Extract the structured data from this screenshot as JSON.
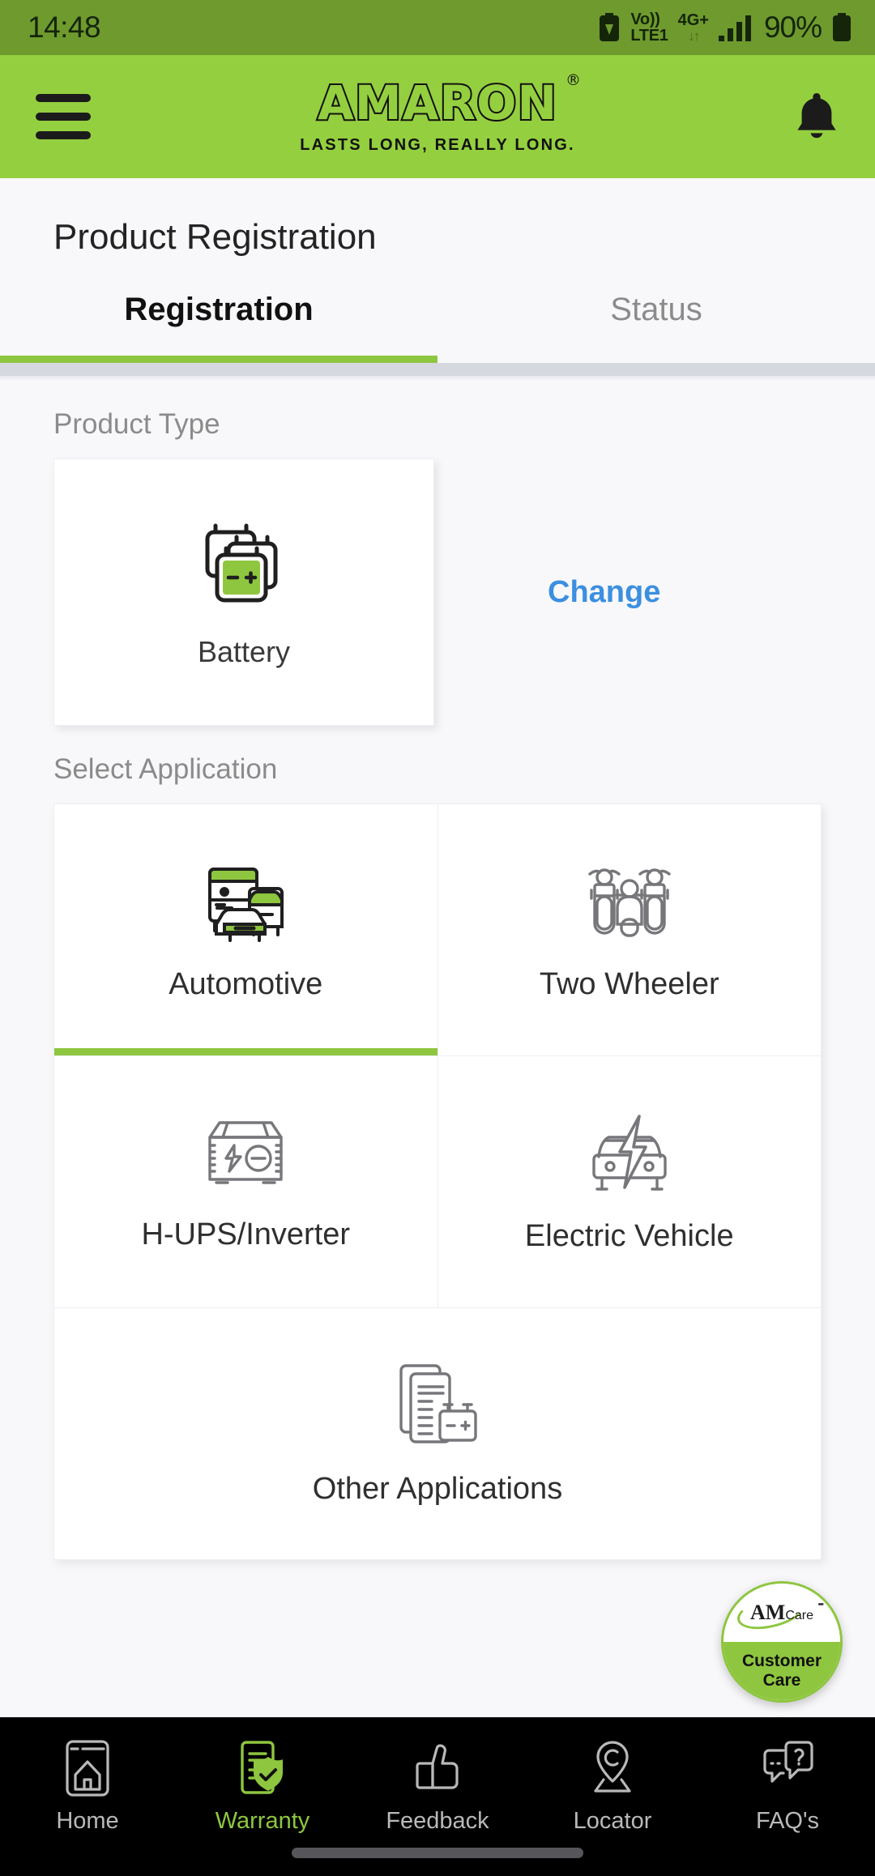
{
  "status_bar": {
    "time": "14:48",
    "battery_saver_icon": "battery-saver-icon",
    "volte_line1": "Vo))",
    "volte_line2": "LTE1",
    "network_type": "4G+",
    "data_arrows": "↓↑",
    "signal_icon": "signal-bars-icon",
    "battery_percent": "90%",
    "battery_icon": "battery-icon"
  },
  "header": {
    "menu_icon": "hamburger-menu-icon",
    "brand_name": "AMARON",
    "brand_registered": "®",
    "tagline": "LASTS LONG, REALLY LONG.",
    "notification_icon": "bell-icon",
    "background_color": "#94cf3f"
  },
  "page": {
    "title": "Product Registration",
    "accent_color": "#8ec63f",
    "link_color": "#3c8fe0"
  },
  "tabs": [
    {
      "label": "Registration",
      "active": true
    },
    {
      "label": "Status",
      "active": false
    }
  ],
  "product_type": {
    "section_label": "Product Type",
    "selected": {
      "label": "Battery",
      "icon": "battery-stack-icon"
    },
    "change_label": "Change"
  },
  "application": {
    "section_label": "Select Application",
    "options": [
      {
        "label": "Automotive",
        "icon": "automotive-vehicles-icon",
        "selected": true
      },
      {
        "label": "Two Wheeler",
        "icon": "two-wheeler-icon",
        "selected": false
      },
      {
        "label": "H-UPS/Inverter",
        "icon": "inverter-box-icon",
        "selected": false
      },
      {
        "label": "Electric Vehicle",
        "icon": "electric-car-icon",
        "selected": false
      },
      {
        "label": "Other Applications",
        "icon": "documents-battery-icon",
        "selected": false
      }
    ]
  },
  "customer_care": {
    "logo_main": "AM",
    "logo_sub": "Care",
    "line1": "Customer",
    "line2": "Care"
  },
  "bottom_nav": [
    {
      "label": "Home",
      "icon": "home-icon",
      "active": false
    },
    {
      "label": "Warranty",
      "icon": "warranty-shield-icon",
      "active": true
    },
    {
      "label": "Feedback",
      "icon": "thumbs-up-icon",
      "active": false
    },
    {
      "label": "Locator",
      "icon": "map-pin-icon",
      "active": false
    },
    {
      "label": "FAQ's",
      "icon": "chat-question-icon",
      "active": false
    }
  ]
}
